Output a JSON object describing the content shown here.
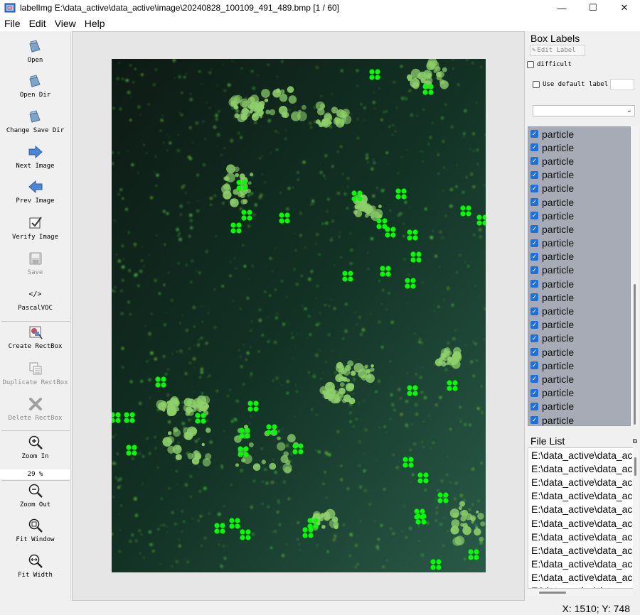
{
  "window": {
    "title": "labelImg E:\\data_active\\data_active\\image\\20240828_100109_491_489.bmp [1 / 60]",
    "controls": {
      "minimize": "—",
      "maximize": "☐",
      "close": "✕"
    }
  },
  "menu": [
    "File",
    "Edit",
    "View",
    "Help"
  ],
  "toolbar": {
    "open": "Open",
    "open_dir": "Open Dir",
    "change_save_dir": "Change Save Dir",
    "next_image": "Next Image",
    "prev_image": "Prev Image",
    "verify_image": "Verify Image",
    "save": "Save",
    "format_icon_text": "</>",
    "format": "PascalVOC",
    "create_rectbox": "Create RectBox",
    "duplicate_rectbox": "Duplicate RectBox",
    "delete_rectbox": "Delete RectBox",
    "zoom_in": "Zoom In",
    "zoom_value": "29 %",
    "zoom_out": "Zoom Out",
    "fit_window": "Fit Window",
    "fit_width": "Fit Width"
  },
  "box_labels": {
    "title": "Box Labels",
    "edit_label": "Edit Label",
    "difficult": "difficult",
    "use_default_label": "Use default label",
    "default_label_value": "",
    "selected_label": "",
    "items": [
      "particle",
      "particle",
      "particle",
      "particle",
      "particle",
      "particle",
      "particle",
      "particle",
      "particle",
      "particle",
      "particle",
      "particle",
      "particle",
      "particle",
      "particle",
      "particle",
      "particle",
      "particle",
      "particle",
      "particle",
      "particle",
      "particle"
    ]
  },
  "file_list": {
    "title": "File List",
    "items": [
      "E:\\data_active\\data_ac",
      "E:\\data_active\\data_ac",
      "E:\\data_active\\data_ac",
      "E:\\data_active\\data_ac",
      "E:\\data_active\\data_ac",
      "E:\\data_active\\data_ac",
      "E:\\data_active\\data_ac",
      "E:\\data_active\\data_ac",
      "E:\\data_active\\data_ac",
      "E:\\data_active\\data_ac",
      "E:\\data_active\\data_ac"
    ]
  },
  "status": "X: 1510; Y: 748",
  "colors": {
    "annotation_point": "#00ff00",
    "label_list_bg": "#a6abb5",
    "checkbox_accent": "#1f6fd6"
  }
}
